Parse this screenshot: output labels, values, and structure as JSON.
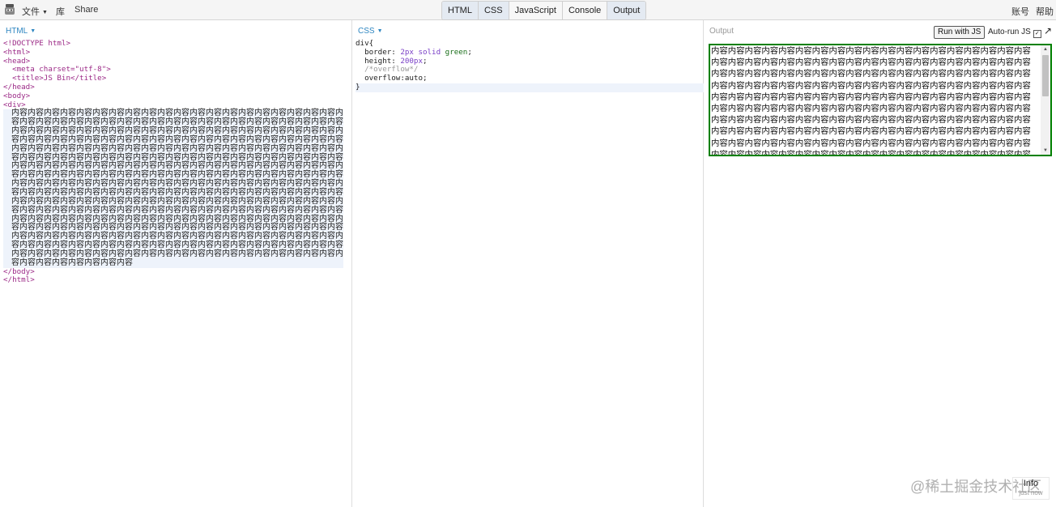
{
  "topbar": {
    "menu_file": "文件",
    "menu_library": "库",
    "menu_share": "Share",
    "tabs": [
      "HTML",
      "CSS",
      "JavaScript",
      "Console",
      "Output"
    ],
    "account": "账号",
    "help": "帮助"
  },
  "html_panel": {
    "label": "HTML",
    "lines_top": [
      "<!DOCTYPE html>",
      "<html>",
      "<head>",
      "  <meta charset=\"utf-8\">",
      "  <title>JS Bin</title>",
      "</head>",
      "<body>",
      "<div>"
    ],
    "content_text": "内容内容内容内容内容内容内容内容内容内容内容内容内容内容内容内容内容内容内容内容内容内容内容内容内容内容内容内容内容内容内容内容内容内容内容内容内容内容内容内容内容内容内容内容内容内容内容内容内容内容内容内容内容内容内容内容内容内容内容内容内容内容内容内容内容内容内容内容内容内容内容内容内容内容内容内容内容内容内容内容内容内容内容内容内容内容内容内容内容内容内容内容内容内容内容内容内容内容内容内容内容内容内容内容内容内容内容内容内容内容内容内容内容内容内容内容内容内容内容内容内容内容内容内容内容内容内容内容内容内容内容内容内容内容内容内容内容内容内容内容内容内容内容内容内容内容内容内容内容内容内容内容内容内容内容内容内容内容内容内容内容内容内容内容内容内容内容内容内容内容内容内容内容内容内容内容内容内容内容内容内容内容内容内容内容内容内容内容内容内容内容内容内容内容内容内容内容内容内容内容内容内容内容内容内容内容内容内容内容内容内容内容内容内容内容内容内容内容内容内容内容内容内容内容内容内容内容内容内容内容内容内容内容内容内容内容内容内容内容内容内容内容内容内容内容内容内容内容内容内容内容内容内容内容内容内容内容内容内容内容内容内容内容内容内容内容内容内容内容内容内容内容内容内容内容内容内容内容内容内容内容内容内容内容内容内容内容内容内容内容内容内容内容内容内容内容内容内容内容内容内容内容内容内容内容内容内容内容内容内容内容内容内容内容内容内容内容内容内容内容内容内容内容内容内容内容内容内容内容内容内容内容内容内容内容内容内容内容内容内容内容内容内容内容内容内容内容内容内容内容内容内容内容内容内容内容",
    "lines_bottom": [
      "</body>",
      "</html>"
    ]
  },
  "css_panel": {
    "label": "CSS",
    "selector": "div{",
    "rules": [
      {
        "prop": "  border: ",
        "value": "2px solid ",
        "value2": "green",
        "end": ";"
      },
      {
        "prop": "  height: ",
        "value": "200px",
        "value2": "",
        "end": ";"
      }
    ],
    "comment": "  /*overflow*/",
    "overflow_rule": "  overflow:auto;",
    "close": "}"
  },
  "output_panel": {
    "label": "Output",
    "run_button": "Run with JS",
    "autorun_label": "Auto-run JS",
    "autorun_checked": "☑",
    "expand_icon": "↗",
    "content_text": "内容内容内容内容内容内容内容内容内容内容内容内容内容内容内容内容内容内容内容内容内容内容内容内容内容内容内容内容内容内容内容内容内容内容内容内容内容内容内容内容内容内容内容内容内容内容内容内容内容内容内容内容内容内容内容内容内容内容内容内容内容内容内容内容内容内容内容内容内容内容内容内容内容内容内容内容内容内容内容内容内容内容内容内容内容内容内容内容内容内容内容内容内容内容内容内容内容内容内容内容内容内容内容内容内容内容内容内容内容内容内容内容内容内容内容内容内容内容内容内容内容内容内容内容内容内容内容内容内容内容内容内容内容内容内容内容内容内容内容内容内容内容内容内容内容内容内容内容内容内容内容内容内容内容内容内容内容内容内容内容内容内容内容内容内容内容内容内容内容内容内容内容内容内容内容内容内容内容内容内容内容内容内容内容内容内容内容内容内容内容内容内容内容内容内容内容内容内容内容内容内容内容内容内容内容内容内容内容内容内容内容内容内容内容内容内容内容内容内容内容内容内容内容内容内容内容内容内容内容内容内容内容内容内容内容内容内容内容内容内容内容内容内容内容内容内容内容内容内容内容内容内容内容内容内容内容内容内容内容内容内容内容内容内容内容内容",
    "border_color": "#008000"
  },
  "overlay": {
    "watermark": "@稀土掘金技术社区",
    "info_label": "Info",
    "info_sub": "just now"
  }
}
